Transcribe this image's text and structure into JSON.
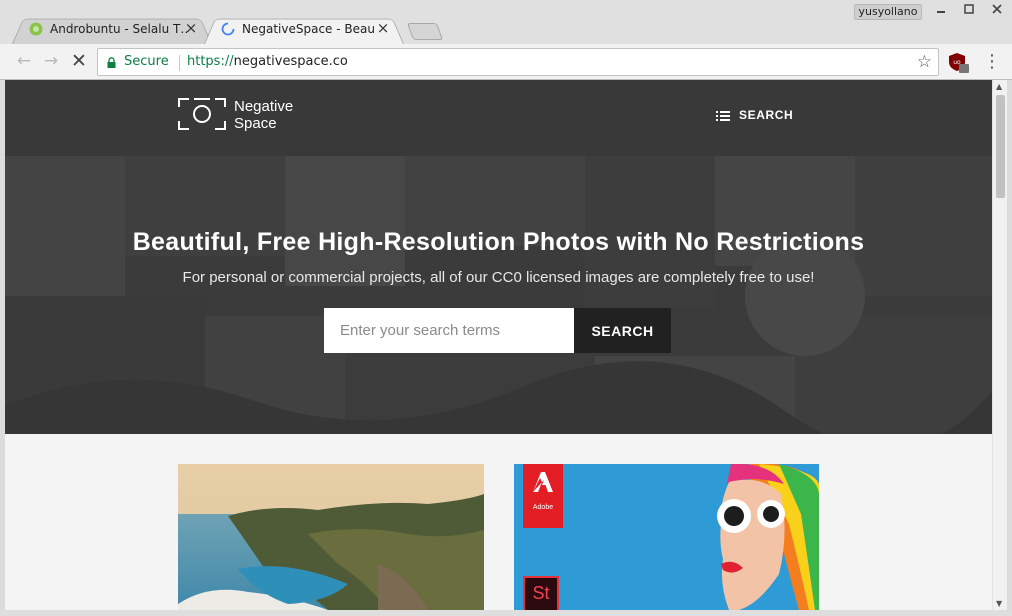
{
  "window": {
    "user_name": "yusyollano",
    "controls": [
      "minimize-icon",
      "maximize-icon",
      "close-icon"
    ]
  },
  "tabs": [
    {
      "title": "Androbuntu - Selalu T…",
      "favicon": "androbuntu-favicon",
      "active": false
    },
    {
      "title": "NegativeSpace - Beau",
      "favicon": "loading-spinner-icon",
      "active": true
    }
  ],
  "toolbar": {
    "secure_label": "Secure",
    "url_scheme": "https://",
    "url_host": "negativespace.co",
    "icons": [
      "back-arrow-icon",
      "forward-arrow-icon",
      "stop-loading-icon",
      "lock-icon",
      "star-icon",
      "ublock-icon",
      "kebab-menu-icon"
    ]
  },
  "site": {
    "logo_line1": "Negative",
    "logo_line2": "Space",
    "nav_search_label": "SEARCH"
  },
  "hero": {
    "title": "Beautiful, Free High-Resolution Photos with No Restrictions",
    "subtitle": "For personal or commercial projects, all of our CC0 licensed images are completely free to use!",
    "search_placeholder": "Enter your search terms",
    "search_button": "SEARCH"
  },
  "cards": [
    {
      "name": "coastal-cliffs-photo"
    },
    {
      "name": "adobe-stock-ad",
      "brand": "Adobe",
      "badge": "St"
    }
  ],
  "colors": {
    "header_bg": "#393939",
    "secure_green": "#0b8043",
    "adobe_red": "#e21d24",
    "button_bg": "#212121"
  }
}
